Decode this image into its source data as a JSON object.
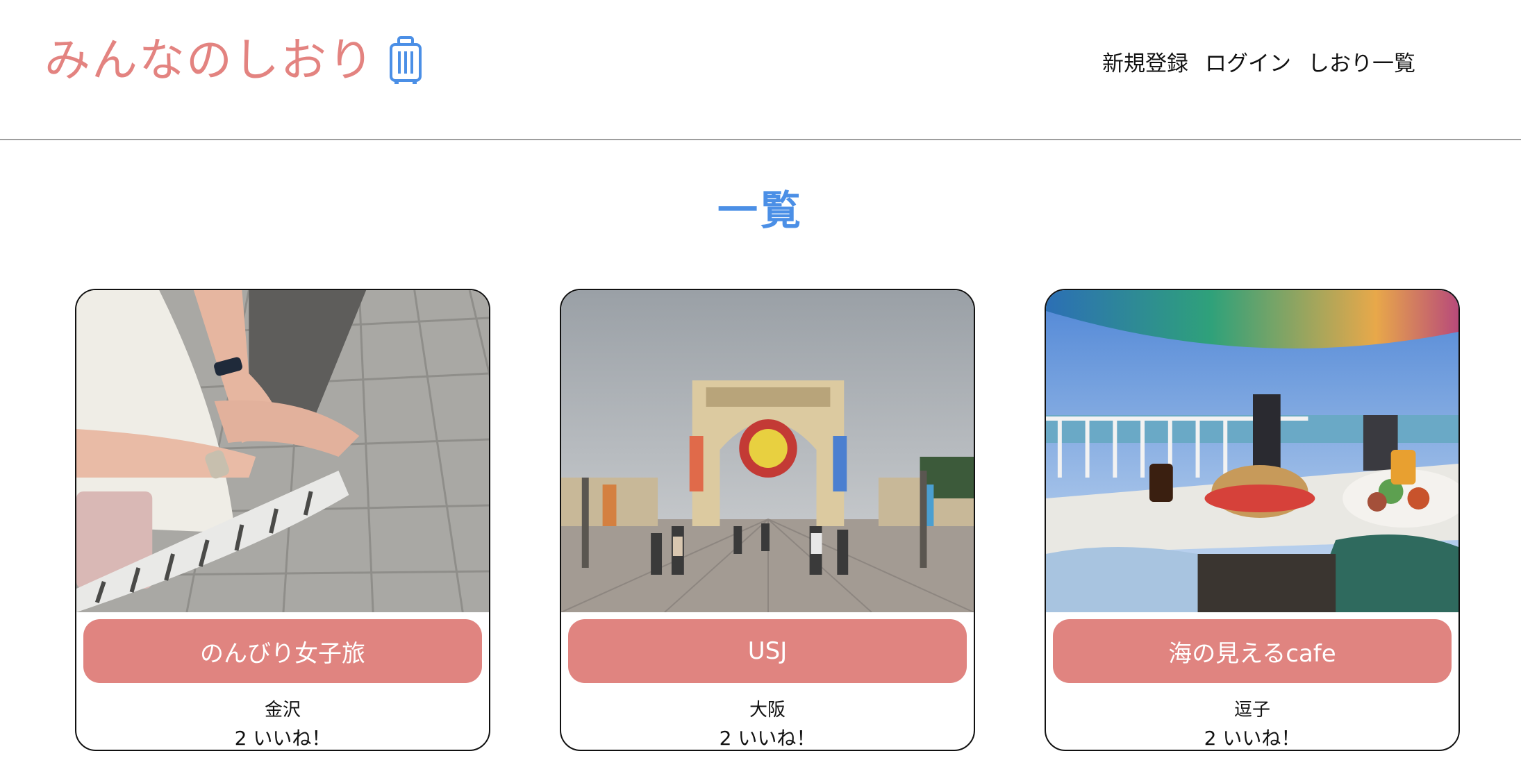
{
  "header": {
    "logo_text": "みんなのしおり",
    "logo_icon": "suitcase-icon",
    "nav": [
      {
        "label": "新規登録"
      },
      {
        "label": "ログイン"
      },
      {
        "label": "しおり一覧"
      }
    ]
  },
  "main": {
    "title": "一覧",
    "cards": [
      {
        "title": "のんびり女子旅",
        "location": "金沢",
        "likes": "2 いいね！",
        "image": "hands-on-pavement-photo"
      },
      {
        "title": "USJ",
        "location": "大阪",
        "likes": "2 いいね！",
        "image": "theme-park-gate-photo"
      },
      {
        "title": "海の見えるcafe",
        "location": "逗子",
        "likes": "2 いいね！",
        "image": "seaside-cafe-photo"
      }
    ]
  },
  "colors": {
    "logo": "#e38380",
    "title": "#4b8fe6",
    "card_button": "#e08480",
    "icon": "#4b8fe6"
  }
}
